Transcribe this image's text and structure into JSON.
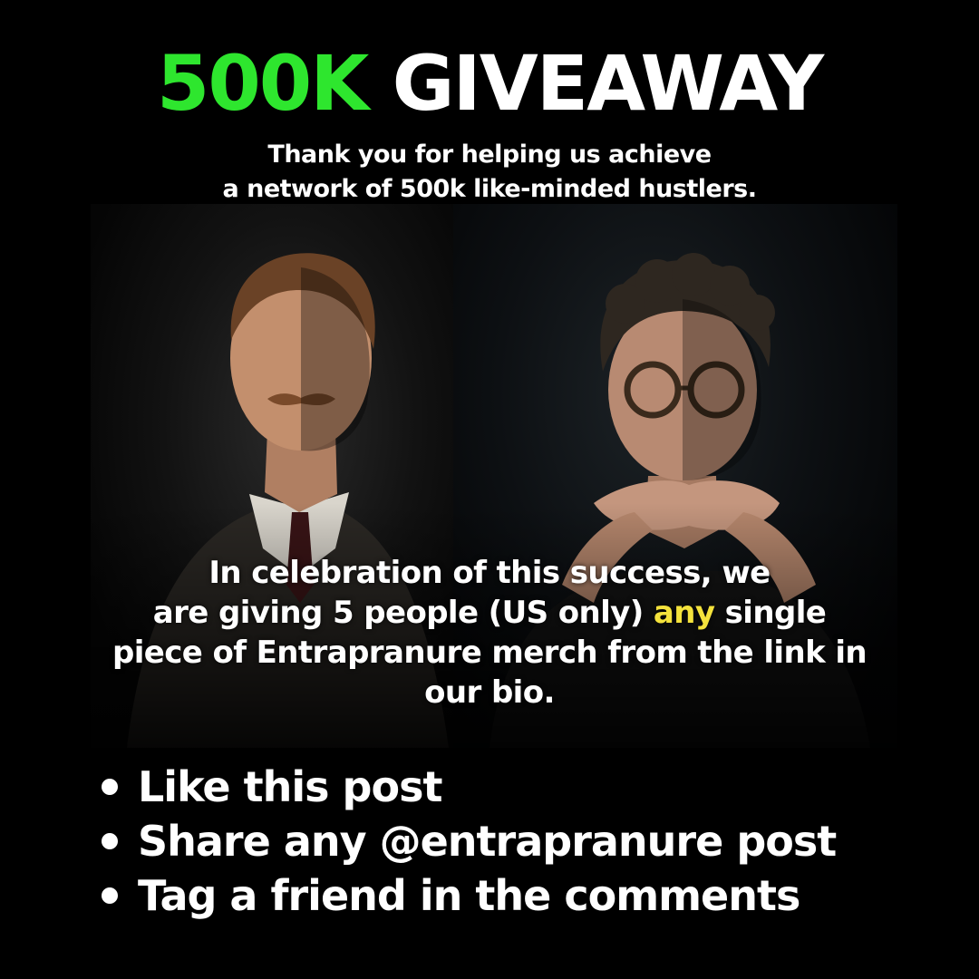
{
  "header": {
    "title_accent": "500K",
    "title_rest": "GIVEAWAY",
    "subtitle_line1": "Thank you for helping us achieve",
    "subtitle_line2": "a network of 500k like-minded hustlers."
  },
  "body": {
    "line1": "In celebration of this success, we",
    "line2_before": "are giving 5 people (US only) ",
    "line2_highlight": "any",
    "line2_after": " single",
    "line3": "piece of Entrapranure merch from the link in",
    "line4": "our bio."
  },
  "bullets": [
    "Like this post",
    "Share any @entrapranure post",
    "Tag a friend in the comments"
  ],
  "colors": {
    "background": "#000000",
    "accent_green": "#2ee62e",
    "highlight_yellow": "#f4e23c",
    "text": "#ffffff"
  },
  "images": {
    "photo": "two-men-portrait-photo"
  }
}
